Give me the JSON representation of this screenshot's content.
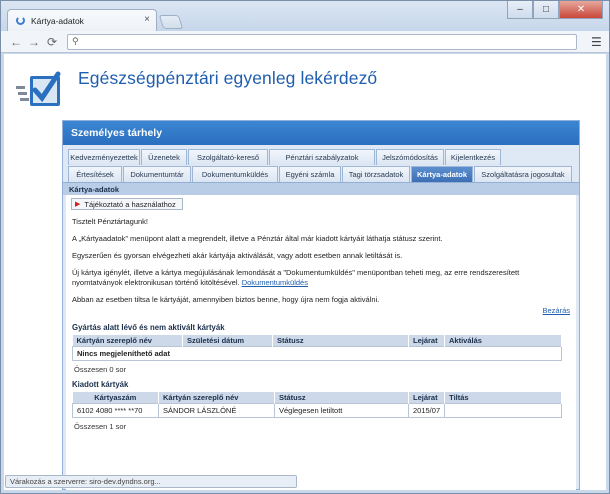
{
  "browser": {
    "tab_title": "Kártya-adatok",
    "tab_close": "×",
    "address": "",
    "status": "Várakozás a szerverre: siro-dev.dyndns.org..."
  },
  "site": {
    "title": "Egészségpénztári egyenleg lekérdező"
  },
  "panel": {
    "heading": "Személyes tárhely",
    "tabs_row1": [
      {
        "label": "Kedvezményezettek"
      },
      {
        "label": "Üzenetek"
      },
      {
        "label": "Szolgáltató-kereső"
      },
      {
        "label": "Pénztári szabályzatok"
      },
      {
        "label": "Jelszómódosítás"
      },
      {
        "label": "Kijelentkezés"
      }
    ],
    "tabs_row2": [
      {
        "label": "Értesítések"
      },
      {
        "label": "Dokumentumtár"
      },
      {
        "label": "Dokumentumküldés"
      },
      {
        "label": "Egyéni számla"
      },
      {
        "label": "Tagi törzsadatok"
      },
      {
        "label": "Kártya-adatok",
        "active": true
      },
      {
        "label": "Szolgáltatásra jogosultak"
      }
    ],
    "subbar": "Kártya-adatok"
  },
  "info": {
    "button": "Tájékoztató a használathoz",
    "p1": "Tisztelt Pénztártagunk!",
    "p2": "A „Kártyaadatok” menüpont alatt a megrendelt, illetve a Pénztár által már kiadott kártyáit láthatja státusz szerint.",
    "p3": "Egyszerűen és gyorsan elvégezheti akár kártyája aktiválását, vagy adott esetben annak letiltását is.",
    "p4a": "Új kártya igénylét, illetve a kártya megújulásának lemondását a \"Dokumentumküldés\" menüpontban teheti meg, az erre rendszeresített nyomtatványok elektronikusan történő kitöltésével.",
    "p4_link": "Dokumentumküldés",
    "p5": "Abban az esetben tiltsa le kártyáját, amennyiben biztos benne, hogy újra nem fogja aktiválni.",
    "close": "Bezárás"
  },
  "pending": {
    "title": "Gyártás alatt lévő és nem aktivált kártyák",
    "headers": [
      "Kártyán szereplő név",
      "Születési dátum",
      "Státusz",
      "Lejárat",
      "Aktiválás"
    ],
    "empty": "Nincs megjeleníthető adat",
    "count": "Összesen 0 sor"
  },
  "issued": {
    "title": "Kiadott kártyák",
    "headers": [
      "Kártyaszám",
      "Kártyán szereplő név",
      "Státusz",
      "Lejárat",
      "Tiltás"
    ],
    "rows": [
      {
        "number": "6102 4080 **** **70",
        "name": "SÁNDOR LÁSZLÓNÉ",
        "status": "Véglegesen letiltott",
        "expiry": "2015/07",
        "block": ""
      }
    ],
    "count": "Összesen 1 sor"
  },
  "colors": {
    "brand_blue": "#1f5eae",
    "header_blue": "#2b6fbf",
    "active_tab": "#3c6fb3"
  }
}
